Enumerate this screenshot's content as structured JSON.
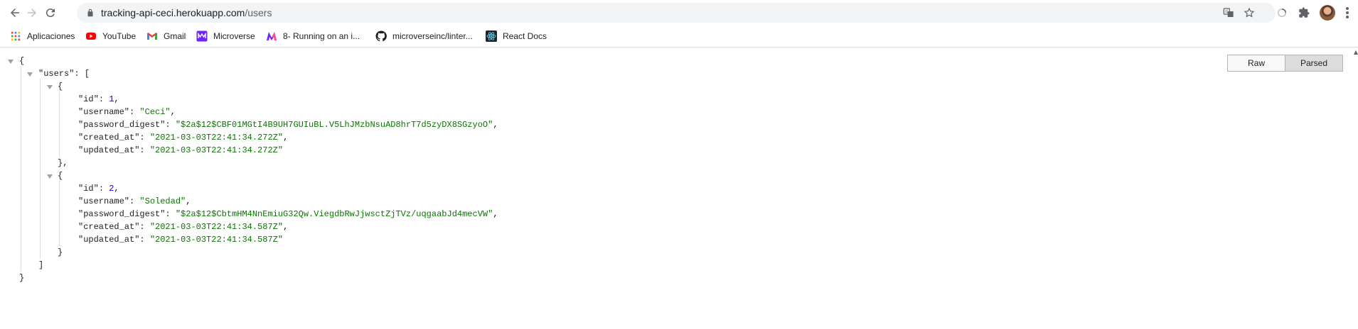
{
  "browser": {
    "url_host": "tracking-api-ceci.herokuapp.com",
    "url_path": "/users"
  },
  "bookmarks": [
    {
      "label": "Aplicaciones",
      "icon": "apps-grid-icon"
    },
    {
      "label": "YouTube",
      "icon": "youtube-icon"
    },
    {
      "label": "Gmail",
      "icon": "gmail-icon"
    },
    {
      "label": "Microverse",
      "icon": "microverse-icon"
    },
    {
      "label": "8- Running on an i...",
      "icon": "microverse-m-icon"
    },
    {
      "label": "microverseinc/linter...",
      "icon": "github-icon"
    },
    {
      "label": "React Docs",
      "icon": "react-icon"
    }
  ],
  "viewer": {
    "raw_label": "Raw",
    "parsed_label": "Parsed"
  },
  "json": {
    "root_key": "\"users\"",
    "users": [
      {
        "id": "1",
        "username": "\"Ceci\"",
        "password_digest": "\"$2a$12$CBF01MGtI4B9UH7GUIuBL.V5LhJMzbNsuAD8hrT7d5zyDX8SGzyoO\"",
        "created_at": "\"2021-03-03T22:41:34.272Z\"",
        "updated_at": "\"2021-03-03T22:41:34.272Z\""
      },
      {
        "id": "2",
        "username": "\"Soledad\"",
        "password_digest": "\"$2a$12$CbtmHM4NnEmiuG32Qw.ViegdbRwJjwsctZjTVz/uqgaabJd4mecVW\"",
        "created_at": "\"2021-03-03T22:41:34.587Z\"",
        "updated_at": "\"2021-03-03T22:41:34.587Z\""
      }
    ],
    "keys": {
      "id": "\"id\"",
      "username": "\"username\"",
      "password_digest": "\"password_digest\"",
      "created_at": "\"created_at\"",
      "updated_at": "\"updated_at\""
    }
  }
}
